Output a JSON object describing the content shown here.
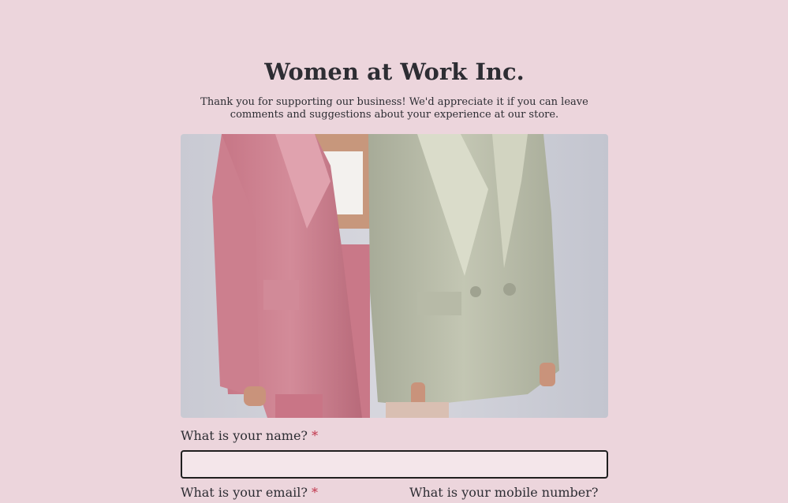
{
  "form": {
    "title": "Women at Work Inc.",
    "description": "Thank you for supporting our business! We'd appreciate it if you can leave comments and suggestions about your experience at our store.",
    "fields": {
      "name": {
        "label": "What is your name?",
        "required_mark": "*",
        "value": "",
        "placeholder": ""
      },
      "email": {
        "label": "What is your email?",
        "required_mark": "*"
      },
      "mobile": {
        "label": "What is your mobile number?"
      }
    }
  },
  "colors": {
    "background": "#ecd5dc",
    "text": "#2d2d33",
    "required": "#c0344a",
    "input_border": "#1f1f1f",
    "input_fill": "#f4e6ea"
  }
}
